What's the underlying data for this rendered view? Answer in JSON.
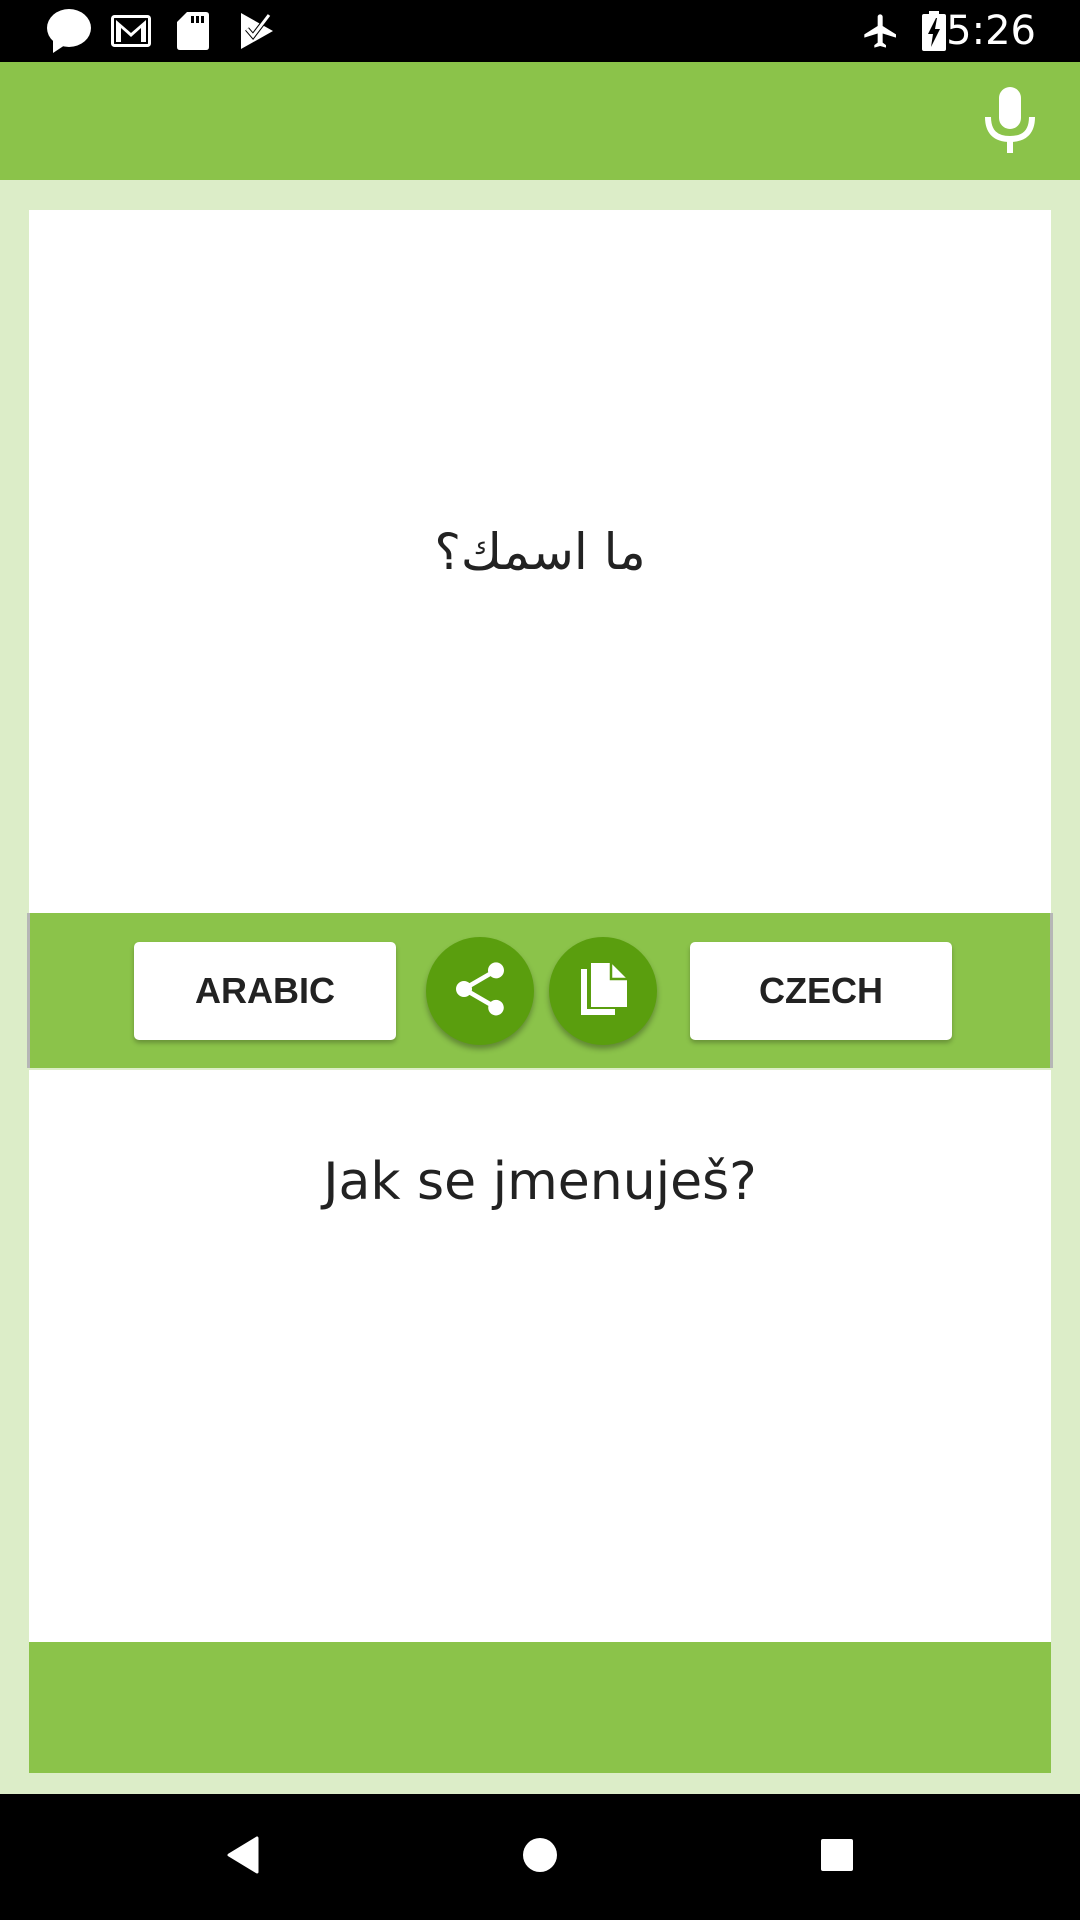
{
  "status_bar": {
    "time": "5:26",
    "left_icons": [
      "message-icon",
      "gmail-icon",
      "sd-card-icon",
      "play-store-check-icon"
    ],
    "right_icons": [
      "airplane-mode-icon",
      "battery-charging-icon"
    ]
  },
  "toolbar": {
    "action_icon": "microphone-icon"
  },
  "translator": {
    "source_text": "ما اسمك؟",
    "target_text": "Jak se jmenuješ?",
    "source_language": "ARABIC",
    "target_language": "CZECH",
    "share_icon": "share-icon",
    "copy_icon": "copy-icon"
  },
  "nav_bar": {
    "buttons": [
      "back",
      "home",
      "recents"
    ]
  },
  "colors": {
    "primary": "#8BC34A",
    "primary_dark": "#5A9E0E",
    "background": "#DCEDC8",
    "text": "#222222"
  }
}
